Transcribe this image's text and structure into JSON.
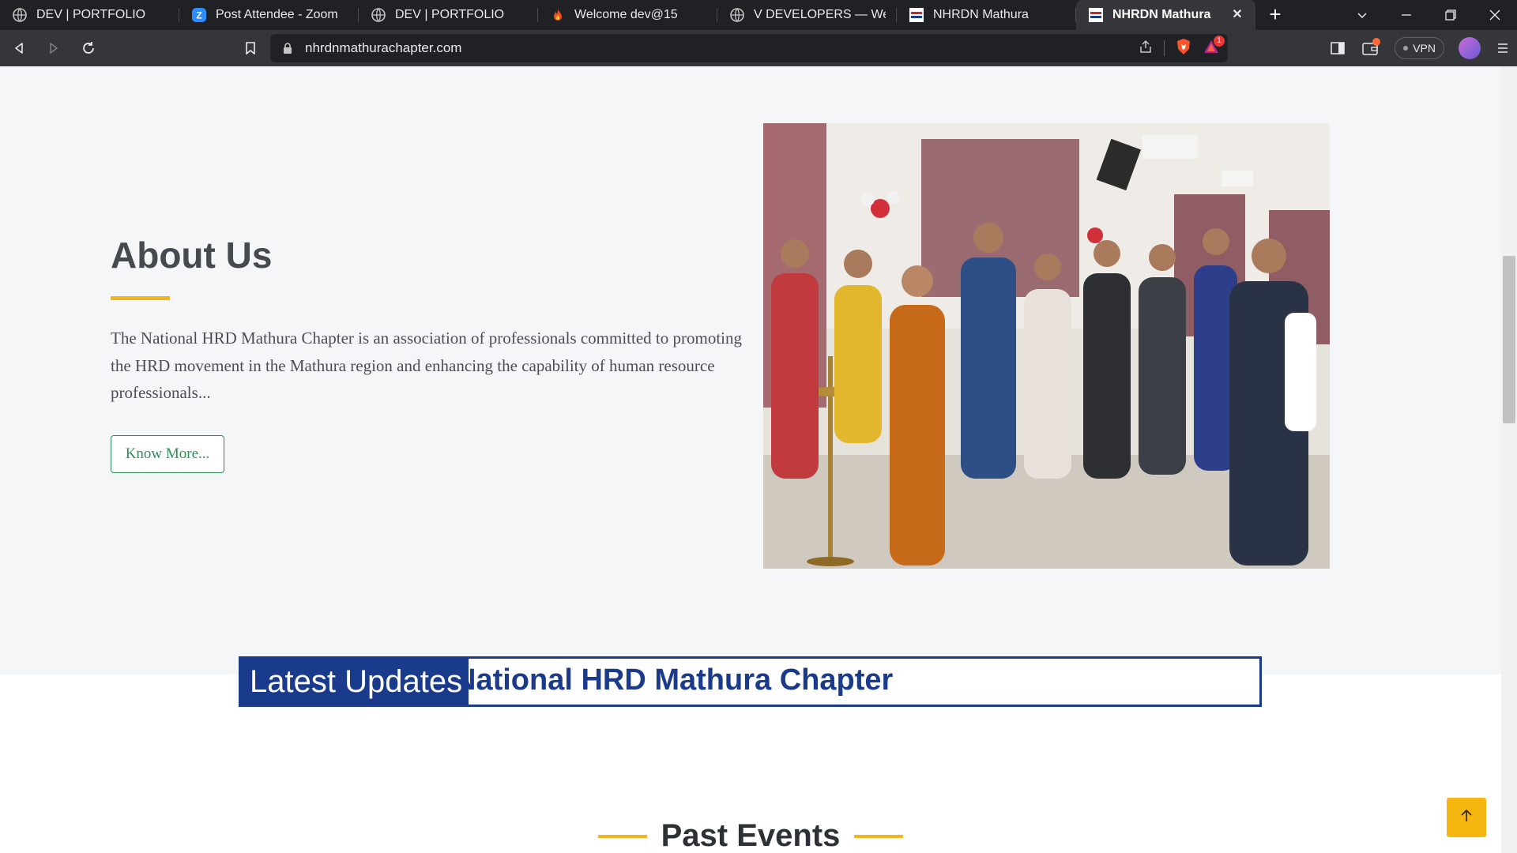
{
  "browser": {
    "tabs": [
      {
        "title": "DEV | PORTFOLIO",
        "icon": "globe-icon"
      },
      {
        "title": "Post Attendee - Zoom",
        "icon": "zoom-icon"
      },
      {
        "title": "DEV | PORTFOLIO",
        "icon": "globe-icon"
      },
      {
        "title": "Welcome dev@15",
        "icon": "flame-icon"
      },
      {
        "title": "V DEVELOPERS — We are t",
        "icon": "globe-icon"
      },
      {
        "title": "NHRDN Mathura",
        "icon": "nhrdn-favicon"
      },
      {
        "title": "NHRDN Mathura",
        "icon": "nhrdn-favicon",
        "active": true
      }
    ],
    "url": "nhrdnmathurachapter.com",
    "vpn_label": "VPN",
    "notification_count": "1"
  },
  "about": {
    "heading": "About Us",
    "body": "The National HRD Mathura Chapter is an association of professionals committed to promoting the HRD movement in the Mathura region and enhancing the capability of human resource professionals...",
    "button_label": "Know More..."
  },
  "updates": {
    "label": "Latest Updates",
    "marquee_text": "National HRD Mathura Chapter"
  },
  "past_events": {
    "heading": "Past Events"
  },
  "colors": {
    "accent_yellow": "#f3b51d",
    "brand_blue": "#1a3b8c",
    "button_green": "#2f8b55"
  }
}
